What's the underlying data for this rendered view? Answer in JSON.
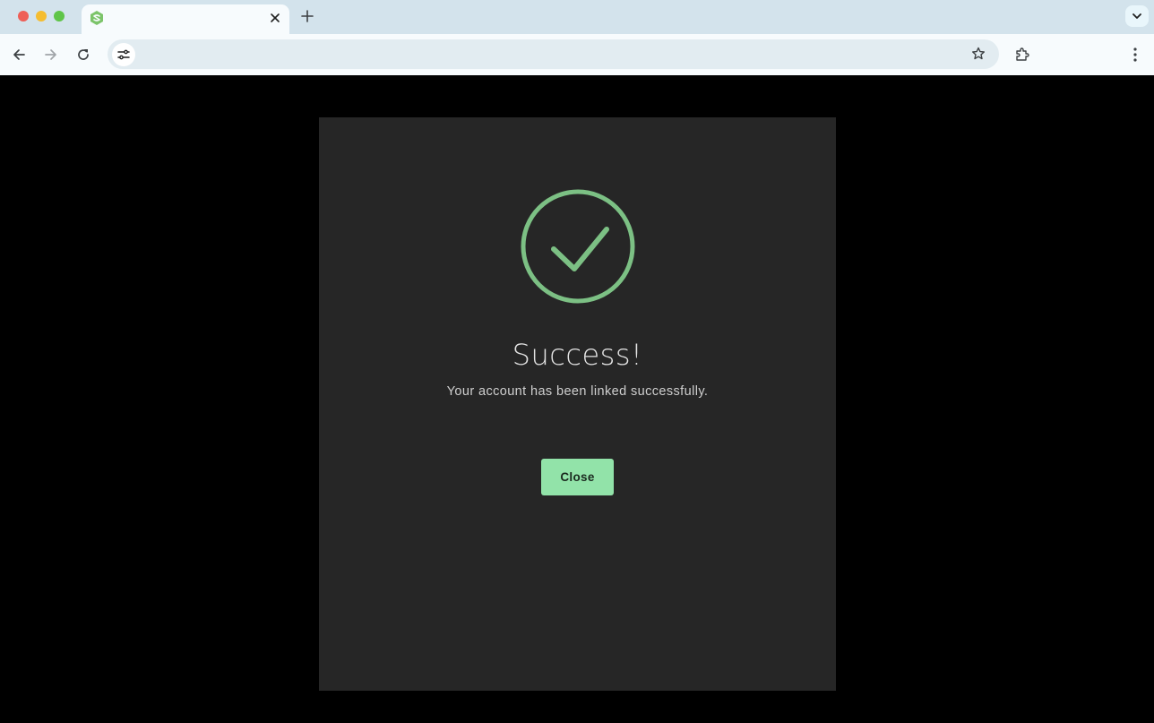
{
  "browser": {
    "tab": {
      "title": "",
      "favicon": "shield-logo-icon",
      "favicon_color": "#7cc46a"
    },
    "address_bar": {
      "value": "",
      "placeholder": ""
    },
    "icons": {
      "back": "back-arrow-icon",
      "forward": "forward-arrow-icon",
      "reload": "reload-icon",
      "site_info": "tune-icon",
      "bookmark": "star-icon",
      "extensions": "puzzle-icon",
      "menu": "kebab-menu-icon",
      "new_tab": "plus-icon",
      "tab_search": "chevron-down-icon",
      "tab_close": "close-icon"
    },
    "colors": {
      "tabstrip": "#d3e3ec",
      "toolbar": "#f7fbfd",
      "omnibox": "#e2ecf1"
    }
  },
  "dialog": {
    "icon": "check-circle-icon",
    "title": "Success!",
    "message": "Your account has been linked successfully.",
    "close_label": "Close",
    "colors": {
      "background": "#262626",
      "accent": "#7cc084",
      "button": "#92e3a9"
    }
  }
}
